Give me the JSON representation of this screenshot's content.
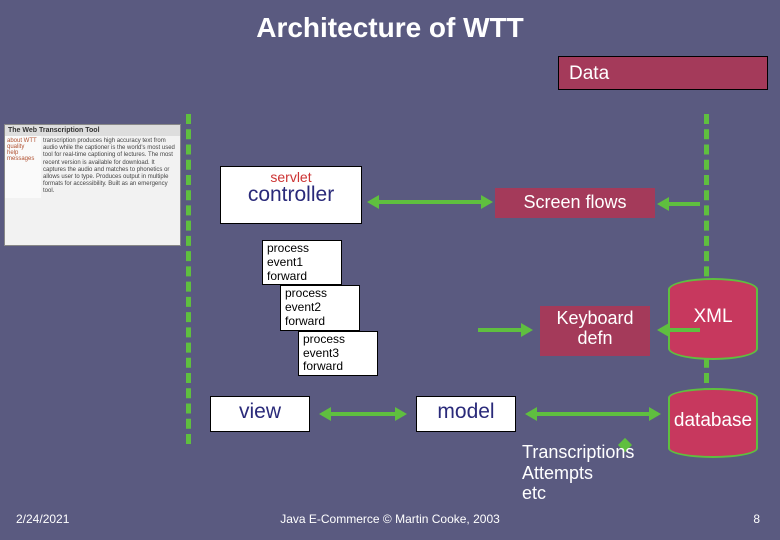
{
  "title": "Architecture of WTT",
  "data_label": "Data",
  "thumb": {
    "header": "The Web Transcription Tool",
    "side": "about WTT\nquality\nhelp\nmessages",
    "main": "transcription produces high accuracy text from audio while the captioner is the world's most used tool for real-time captioning of lectures. The most recent version is available for download. It captures the audio and matches to phonetics or allows user to type. Produces output in multiple formats for accessibility. Built as an emergency tool."
  },
  "controller": {
    "servlet": "servlet",
    "label": "controller"
  },
  "screen_flows": "Screen flows",
  "events": [
    {
      "p": "process",
      "e": "event1",
      "f": "forward"
    },
    {
      "p": "process",
      "e": "event2",
      "f": "forward"
    },
    {
      "p": "process",
      "e": "event3",
      "f": "forward"
    }
  ],
  "view": "view",
  "model": "model",
  "keyboard": "Keyboard defn",
  "cyl_xml": "XML",
  "cyl_db": "database",
  "transcriptions": "Transcriptions\nAttempts\netc",
  "footer": {
    "date": "2/24/2021",
    "mid": "Java E-Commerce © Martin Cooke, 2003",
    "num": "8"
  }
}
